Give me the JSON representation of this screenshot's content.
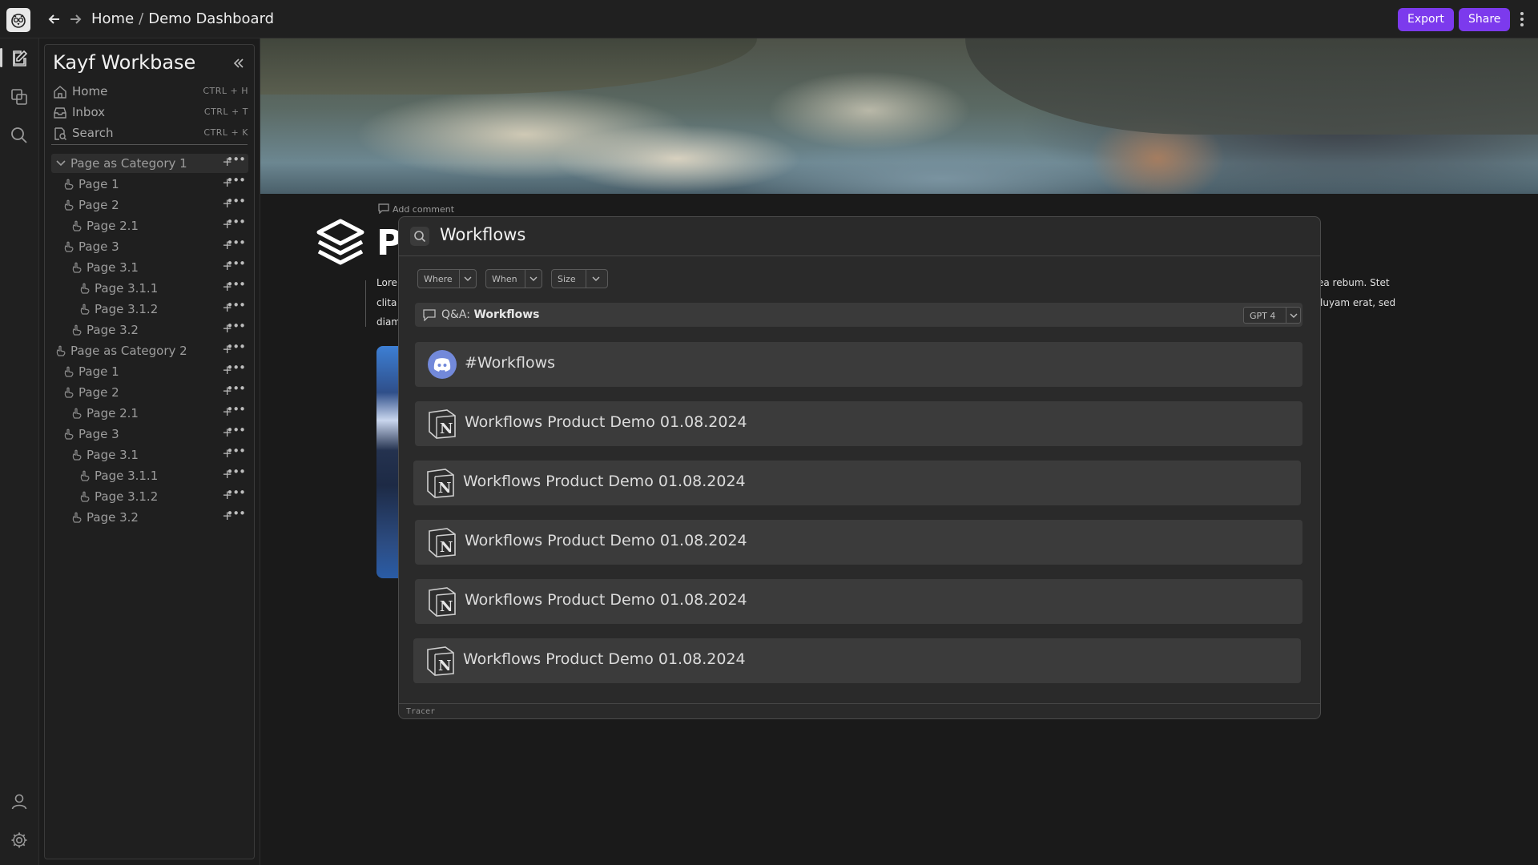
{
  "topbar": {
    "breadcrumb_home": "Home",
    "breadcrumb_sep": "/",
    "breadcrumb_current": "Demo Dashboard",
    "export_label": "Export",
    "share_label": "Share"
  },
  "colors": {
    "accent": "#7c3aed",
    "panel": "#2a2a2a",
    "result": "#3b3b3b"
  },
  "sidebar": {
    "title": "Kayf Workbase",
    "quick": [
      {
        "label": "Home",
        "shortcut": "CTRL + H",
        "icon": "home-icon"
      },
      {
        "label": "Inbox",
        "shortcut": "CTRL + T",
        "icon": "inbox-icon"
      },
      {
        "label": "Search",
        "shortcut": "CTRL + K",
        "icon": "search-icon"
      }
    ],
    "tree": [
      {
        "label": "Page as Category 1"
      },
      {
        "label": "Page 1"
      },
      {
        "label": "Page 2"
      },
      {
        "label": "Page 2.1"
      },
      {
        "label": "Page 3"
      },
      {
        "label": "Page 3.1"
      },
      {
        "label": "Page 3.1.1"
      },
      {
        "label": "Page 3.1.2"
      },
      {
        "label": "Page 3.2"
      },
      {
        "label": "Page as Category 2"
      },
      {
        "label": "Page 1"
      },
      {
        "label": "Page 2"
      },
      {
        "label": "Page 2.1"
      },
      {
        "label": "Page 3"
      },
      {
        "label": "Page 3.1"
      },
      {
        "label": "Page 3.1.1"
      },
      {
        "label": "Page 3.1.2"
      },
      {
        "label": "Page 3.2"
      }
    ],
    "plus": "+",
    "dots": "•••"
  },
  "page": {
    "add_comment": "Add comment",
    "title_initial": "P",
    "body_left": [
      "Lore",
      "clita",
      "diam"
    ],
    "body_right": [
      "ea rebum. Stet",
      "luyam erat, sed"
    ]
  },
  "search": {
    "query": "Workflows",
    "filters": [
      "Where",
      "When",
      "Size"
    ],
    "qa_prefix": "Q&A:",
    "qa_query": "Workflows",
    "model": "GPT 4",
    "results": [
      {
        "label": "#Workflows",
        "source": "discord-icon"
      },
      {
        "label": "Workflows Product Demo 01.08.2024",
        "source": "notion-icon"
      },
      {
        "label": "Workflows Product Demo 01.08.2024",
        "source": "notion-icon"
      },
      {
        "label": "Workflows Product Demo 01.08.2024",
        "source": "notion-icon"
      },
      {
        "label": "Workflows Product Demo 01.08.2024",
        "source": "notion-icon"
      },
      {
        "label": "Workflows Product Demo 01.08.2024",
        "source": "notion-icon"
      }
    ],
    "footer": "Tracer"
  }
}
